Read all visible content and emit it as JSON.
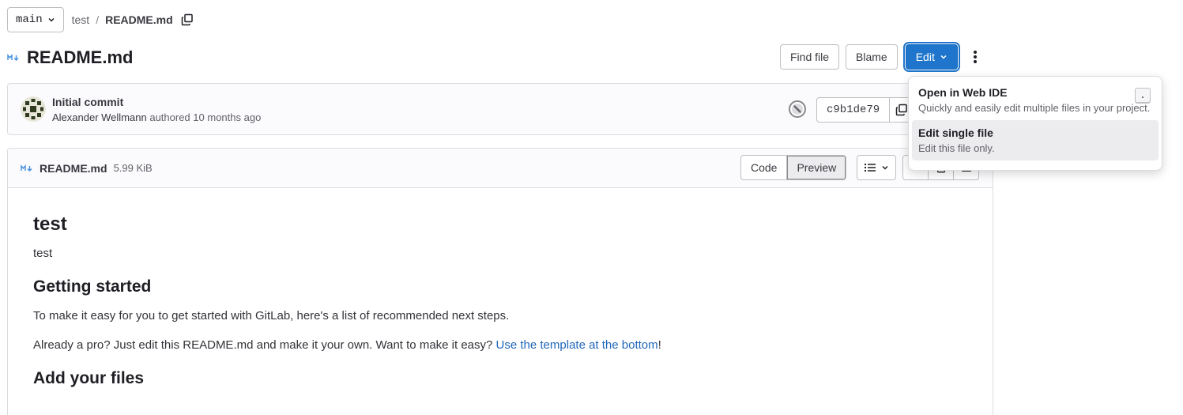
{
  "breadcrumb": {
    "branch": "main",
    "project": "test",
    "separator": "/",
    "file": "README.md"
  },
  "header": {
    "title": "README.md",
    "find_file": "Find file",
    "blame": "Blame",
    "edit": "Edit"
  },
  "commit": {
    "title": "Initial commit",
    "author": "Alexander Wellmann",
    "authored": "authored",
    "time": "10 months ago",
    "sha": "c9b1de79"
  },
  "file": {
    "name": "README.md",
    "size": "5.99 KiB",
    "code_label": "Code",
    "preview_label": "Preview"
  },
  "content": {
    "h1": "test",
    "p1": "test",
    "h2_getting_started": "Getting started",
    "p2": "To make it easy for you to get started with GitLab, here's a list of recommended next steps.",
    "p3_before": "Already a pro? Just edit this README.md and make it your own. Want to make it easy? ",
    "p3_link": "Use the template at the bottom",
    "p3_after": "!",
    "h2_add_files": "Add your files"
  },
  "dropdown": {
    "items": [
      {
        "title": "Open in Web IDE",
        "desc": "Quickly and easily edit multiple files in your project.",
        "shortcut": "."
      },
      {
        "title": "Edit single file",
        "desc": "Edit this file only."
      }
    ]
  },
  "colors": {
    "primary": "#1f75cb",
    "link": "#1f66b9"
  },
  "icons": {
    "markdown": "markdown-icon",
    "copy": "copy-icon",
    "chevron": "chevron-down-icon",
    "kebab": "kebab-menu-icon",
    "pipeline": "pipeline-status-icon",
    "toc": "list-icon"
  }
}
